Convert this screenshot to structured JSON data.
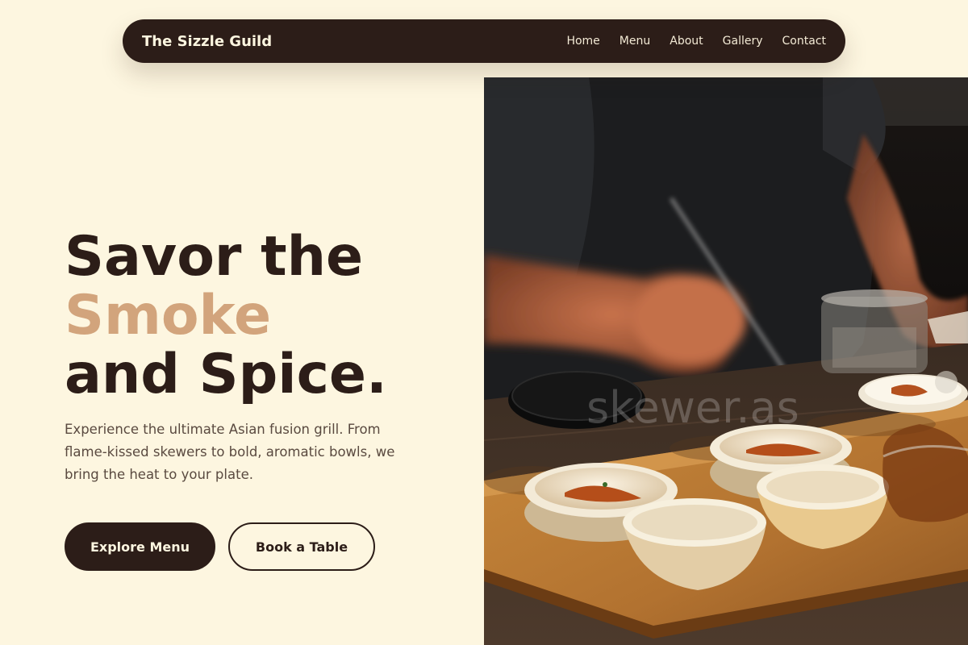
{
  "brand": {
    "name": "The Sizzle Guild"
  },
  "nav": {
    "links": [
      "Home",
      "Menu",
      "About",
      "Gallery",
      "Contact"
    ]
  },
  "hero": {
    "headline_line1": "Savor the",
    "headline_accent": "Smoke",
    "headline_line3": "and Spice.",
    "tagline": "Experience the ultimate Asian fusion grill. From flame-kissed skewers to bold, aromatic bowls, we bring the heat to your plate.",
    "primary_cta": "Explore Menu",
    "secondary_cta": "Book a Table",
    "image_watermark": "skewer.as"
  },
  "colors": {
    "background": "#fdf6e0",
    "dark": "#2c1d18",
    "accent": "#d2a47c"
  }
}
